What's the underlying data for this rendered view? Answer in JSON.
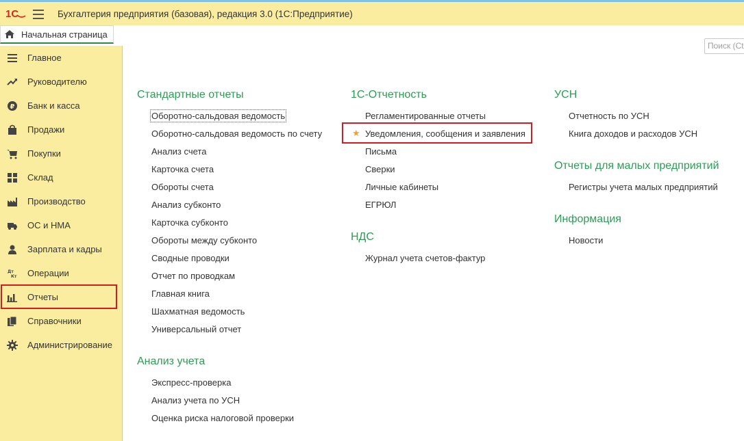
{
  "titlebar": {
    "title": "Бухгалтерия предприятия (базовая), редакция 3.0  (1С:Предприятие)"
  },
  "home_tab": {
    "label": "Начальная страница"
  },
  "search": {
    "placeholder": "Поиск (Ct"
  },
  "sidebar": {
    "items": [
      {
        "label": "Главное",
        "icon": "menu-lines-icon"
      },
      {
        "label": "Руководителю",
        "icon": "trend-up-icon"
      },
      {
        "label": "Банк и касса",
        "icon": "ruble-icon"
      },
      {
        "label": "Продажи",
        "icon": "bag-icon"
      },
      {
        "label": "Покупки",
        "icon": "cart-icon"
      },
      {
        "label": "Склад",
        "icon": "grid-icon"
      },
      {
        "label": "Производство",
        "icon": "factory-icon"
      },
      {
        "label": "ОС и НМА",
        "icon": "truck-icon"
      },
      {
        "label": "Зарплата и кадры",
        "icon": "person-icon"
      },
      {
        "label": "Операции",
        "icon": "dt-kt-icon"
      },
      {
        "label": "Отчеты",
        "icon": "bar-chart-icon"
      },
      {
        "label": "Справочники",
        "icon": "books-icon"
      },
      {
        "label": "Администрирование",
        "icon": "gear-icon"
      }
    ]
  },
  "sections": {
    "standard": {
      "title": "Стандартные отчеты",
      "links": [
        "Оборотно-сальдовая ведомость",
        "Оборотно-сальдовая ведомость по счету",
        "Анализ счета",
        "Карточка счета",
        "Обороты счета",
        "Анализ субконто",
        "Карточка субконто",
        "Обороты между субконто",
        "Сводные проводки",
        "Отчет по проводкам",
        "Главная книга",
        "Шахматная ведомость",
        "Универсальный отчет"
      ]
    },
    "analysis": {
      "title": "Анализ учета",
      "links": [
        "Экспресс-проверка",
        "Анализ учета по УСН",
        "Оценка риска налоговой проверки"
      ]
    },
    "reporting1c": {
      "title": "1С-Отчетность",
      "links": [
        "Регламентированные отчеты",
        "Уведомления, сообщения и заявления",
        "Письма",
        "Сверки",
        "Личные кабинеты",
        "ЕГРЮЛ"
      ]
    },
    "vat": {
      "title": "НДС",
      "links": [
        "Журнал учета счетов-фактур"
      ]
    },
    "usn": {
      "title": "УСН",
      "links": [
        "Отчетность по УСН",
        "Книга доходов и расходов УСН"
      ]
    },
    "small": {
      "title": "Отчеты для малых предприятий",
      "links": [
        "Регистры учета малых предприятий"
      ]
    },
    "info": {
      "title": "Информация",
      "links": [
        "Новости"
      ]
    }
  },
  "colors": {
    "sidebar_bg": "#fbeda0",
    "section_title": "#2c9d54",
    "highlight_box": "#d71920",
    "star": "#f0a22c"
  }
}
